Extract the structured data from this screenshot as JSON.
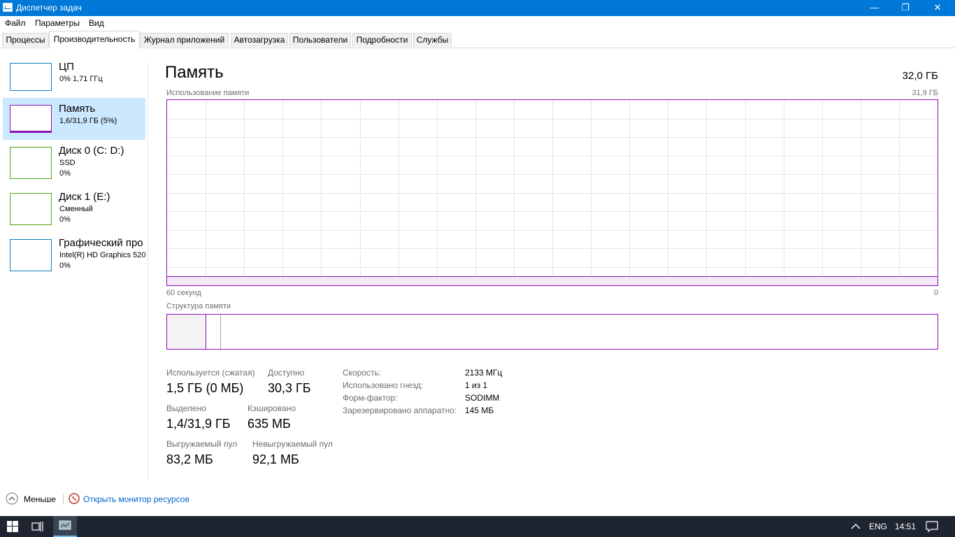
{
  "window": {
    "title": "Диспетчер задач",
    "minimize": "—",
    "maximize": "❐",
    "close": "✕"
  },
  "menu": [
    "Файл",
    "Параметры",
    "Вид"
  ],
  "tabs": [
    "Процессы",
    "Производительность",
    "Журнал приложений",
    "Автозагрузка",
    "Пользователи",
    "Подробности",
    "Службы"
  ],
  "active_tab": "Производительность",
  "resources": [
    {
      "name": "ЦП",
      "line1": "0% 1,71 ГГц",
      "line2": "",
      "color": "#117dbb"
    },
    {
      "name": "Память",
      "line1": "1,6/31,9 ГБ (5%)",
      "line2": "",
      "color": "#8b12ae"
    },
    {
      "name": "Диск 0 (C: D:)",
      "line1": "SSD",
      "line2": "0%",
      "color": "#4da60c"
    },
    {
      "name": "Диск 1 (E:)",
      "line1": "Сменный",
      "line2": "0%",
      "color": "#4da60c"
    },
    {
      "name": "Графический про",
      "line1": "Intel(R) HD Graphics 520",
      "line2": "0%",
      "color": "#117dbb"
    }
  ],
  "main": {
    "title": "Память",
    "total": "32,0 ГБ",
    "usage_label": "Использование памяти",
    "usage_max": "31,9 ГБ",
    "time_left": "60 секунд",
    "time_right": "0",
    "structure_label": "Структура памяти",
    "accent": "#8b12ae"
  },
  "usage_chart": {
    "type": "area",
    "fraction": 0.05
  },
  "stats": {
    "used_label": "Используется (сжатая)",
    "used_value": "1,5 ГБ (0 МБ)",
    "avail_label": "Доступно",
    "avail_value": "30,3 ГБ",
    "commit_label": "Выделено",
    "commit_value": "1,4/31,9 ГБ",
    "cached_label": "Кэшировано",
    "cached_value": "635 МБ",
    "paged_label": "Выгружаемый пул",
    "paged_value": "83,2 МБ",
    "nonpaged_label": "Невыгружаемый пул",
    "nonpaged_value": "92,1 МБ"
  },
  "keyvals": [
    {
      "k": "Скорость:",
      "v": "2133 МГц"
    },
    {
      "k": "Использовано гнезд:",
      "v": "1 из 1"
    },
    {
      "k": "Форм-фактор:",
      "v": "SODIMM"
    },
    {
      "k": "Зарезервировано аппаратно:",
      "v": "145 МБ"
    }
  ],
  "bottom": {
    "less": "Меньше",
    "open_monitor": "Открыть монитор ресурсов"
  },
  "taskbar": {
    "lang": "ENG",
    "time": "14:51"
  }
}
